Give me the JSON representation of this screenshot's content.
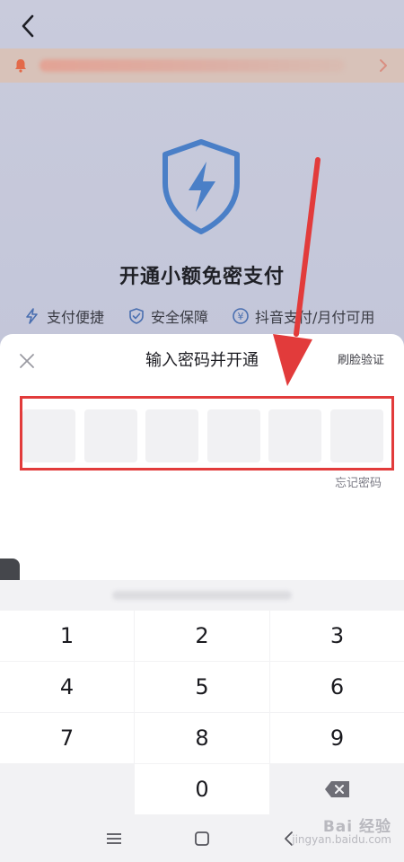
{
  "background_page": {
    "title": "开通小额免密支付",
    "features": [
      {
        "label": "支付便捷",
        "icon": "lightning-icon"
      },
      {
        "label": "安全保障",
        "icon": "shield-check-icon"
      },
      {
        "label": "抖音支付/月付可用",
        "icon": "yen-icon"
      }
    ]
  },
  "sheet": {
    "title": "输入密码并开通",
    "face_verify_label": "刷脸验证",
    "forgot_label": "忘记密码",
    "pin_length": 6
  },
  "keypad": {
    "keys": [
      "1",
      "2",
      "3",
      "4",
      "5",
      "6",
      "7",
      "8",
      "9",
      "",
      "0",
      "delete"
    ]
  },
  "watermark": {
    "line1": "Bai 经验",
    "line2": "jingyan.baidu.com"
  },
  "colors": {
    "annotation_red": "#e23b3b",
    "shield_blue": "#4a7fc7",
    "accent_blue": "#4a6fb0"
  }
}
